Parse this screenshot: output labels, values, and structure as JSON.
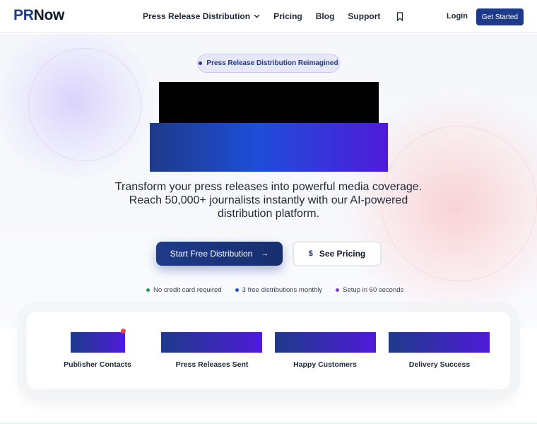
{
  "header": {
    "logo_pr": "PR",
    "logo_now": "Now",
    "nav": [
      {
        "label": "Press Release Distribution",
        "has_dropdown": true
      },
      {
        "label": "Pricing"
      },
      {
        "label": "Blog"
      },
      {
        "label": "Support"
      }
    ],
    "login_label": "Login",
    "cta_label": "Get Started"
  },
  "hero": {
    "badge_text": "Press Release Distribution Reimagined",
    "subtitle": "Transform your press releases into powerful media coverage. Reach 50,000+ journalists instantly with our AI-powered distribution platform.",
    "primary_button": "Start Free Distribution",
    "secondary_button": "See Pricing",
    "features": [
      {
        "text": "No credit card required",
        "color": "#16a34a"
      },
      {
        "text": "3 free distributions monthly",
        "color": "#1d4ed8"
      },
      {
        "text": "Setup in 60 seconds",
        "color": "#7c3aed"
      }
    ]
  },
  "stats": [
    {
      "label": "Publisher Contacts"
    },
    {
      "label": "Press Releases Sent"
    },
    {
      "label": "Happy Customers"
    },
    {
      "label": "Delivery Success"
    }
  ],
  "colors": {
    "brand": "#1e3a8a",
    "accent": "#4f1bd9"
  }
}
